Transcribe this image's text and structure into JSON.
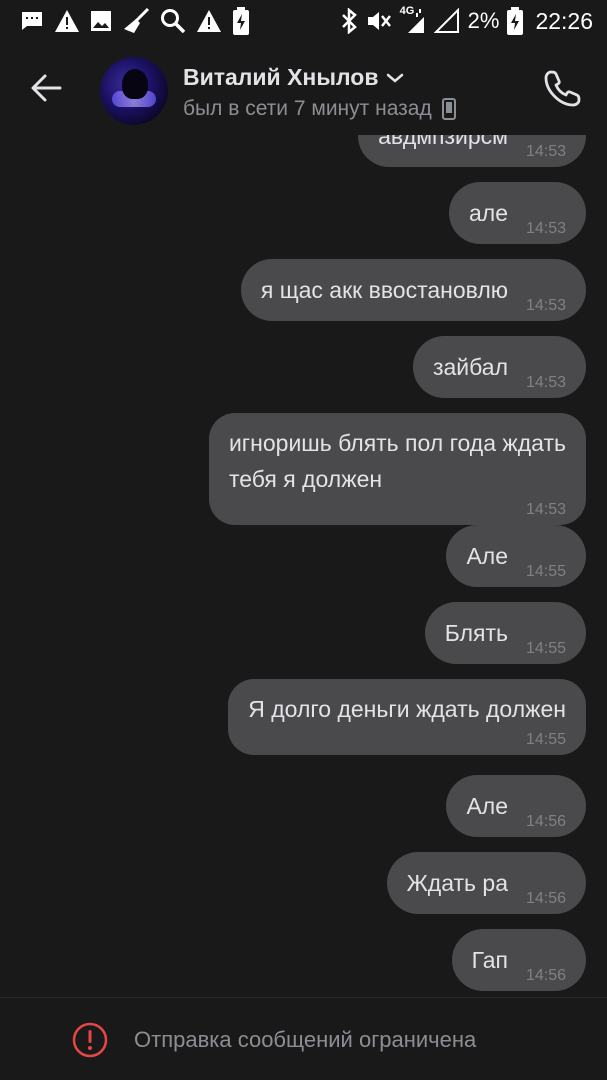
{
  "status_bar": {
    "battery_percent": "2%",
    "time": "22:26",
    "network": "4G"
  },
  "header": {
    "contact_name": "Виталий Хнылов",
    "contact_status": "был в сети 7 минут назад"
  },
  "messages": [
    {
      "text": "авдмпзирсм",
      "time": "14:53"
    },
    {
      "text": "але",
      "time": "14:53"
    },
    {
      "text": "я щас акк ввостановлю",
      "time": "14:53"
    },
    {
      "text": "зайбал",
      "time": "14:53"
    },
    {
      "text_line1": "игноришь блять пол года ждать",
      "text_line2": "тебя я должен",
      "time": "14:53"
    },
    {
      "text": "Але",
      "time": "14:55"
    },
    {
      "text": "Блять",
      "time": "14:55"
    },
    {
      "text": "Я долго деньги ждать должен",
      "time": "14:55"
    },
    {
      "text": "Але",
      "time": "14:56"
    },
    {
      "text": "Ждать ра",
      "time": "14:56"
    },
    {
      "text": "Гап",
      "time": "14:56"
    }
  ],
  "footer": {
    "restriction_text": "Отправка сообщений ограничена"
  },
  "colors": {
    "background": "#19191a",
    "bubble": "#4a4a4d",
    "warning": "#e64646"
  }
}
